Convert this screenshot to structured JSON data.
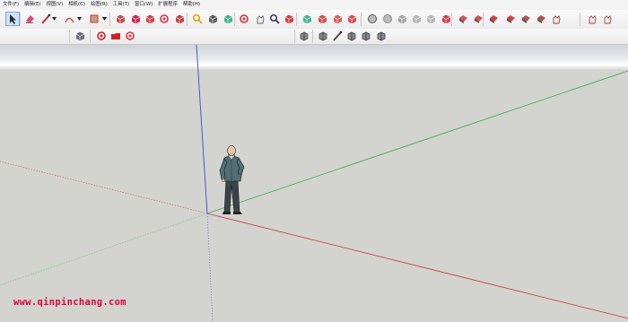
{
  "menu": [
    "文件(F)",
    "编辑(E)",
    "视图(V)",
    "相机(C)",
    "绘图(R)",
    "工具(T)",
    "窗口(W)",
    "扩展程序",
    "帮助(H)"
  ],
  "toolbar": {
    "tools": [
      {
        "name": "select-tool-icon",
        "color": "#2a2a2a"
      },
      {
        "name": "eraser-tool-icon",
        "color": "#e0487a"
      },
      {
        "name": "line-tool-icon",
        "color": "#c0202a"
      },
      {
        "name": "arc-tool-icon",
        "color": "#d24040"
      },
      {
        "name": "rectangle-tool-icon",
        "color": "#c83434"
      },
      {
        "name": "push-pull-tool-icon",
        "color": "#b33"
      },
      {
        "name": "offset-tool-icon",
        "color": "#c03"
      },
      {
        "name": "move-tool-icon",
        "color": "#c22"
      },
      {
        "name": "rotate-tool-icon",
        "color": "#c33"
      },
      {
        "name": "scale-tool-icon",
        "color": "#b22"
      },
      {
        "name": "tape-measure-icon",
        "color": "#e0a000"
      },
      {
        "name": "text-tool-icon",
        "color": "#444"
      },
      {
        "name": "paint-bucket-icon",
        "color": "#2a7"
      },
      {
        "name": "orbit-tool-icon",
        "color": "#c33"
      },
      {
        "name": "pan-tool-icon",
        "color": "#666"
      },
      {
        "name": "zoom-tool-icon",
        "color": "#336"
      },
      {
        "name": "zoom-extents-icon",
        "color": "#c22"
      },
      {
        "name": "warehouse-icon",
        "color": "#2a8"
      },
      {
        "name": "extension-warehouse-icon",
        "color": "#c33"
      },
      {
        "name": "component-icon",
        "color": "#c44"
      },
      {
        "name": "layout-icon",
        "color": "#c33"
      },
      {
        "name": "solid-tools-icon",
        "color": "#555"
      },
      {
        "name": "section-plane-icon",
        "color": "#888"
      },
      {
        "name": "sandbox-icon",
        "color": "#999"
      },
      {
        "name": "follow-me-icon",
        "color": "#aaa"
      },
      {
        "name": "intersect-icon",
        "color": "#aaa"
      },
      {
        "name": "outer-shell-icon",
        "color": "#c22"
      },
      {
        "name": "view-iso-icon",
        "color": "#c55"
      },
      {
        "name": "view-top-icon",
        "color": "#c55"
      },
      {
        "name": "view-front-icon",
        "color": "#c44"
      },
      {
        "name": "view-right-icon",
        "color": "#c44"
      },
      {
        "name": "view-back-icon",
        "color": "#a55"
      },
      {
        "name": "view-left-icon",
        "color": "#a55"
      },
      {
        "name": "hand-icon",
        "color": "#a33"
      },
      {
        "name": "walk-icon",
        "color": "#a44"
      },
      {
        "name": "look-around-icon",
        "color": "#a44"
      }
    ],
    "row2_left": [
      {
        "name": "position-camera-icon",
        "color": "#556"
      },
      {
        "name": "shadows-icon",
        "color": "#c22"
      },
      {
        "name": "folder-icon",
        "color": "#c22"
      },
      {
        "name": "fog-icon",
        "color": "#d33"
      }
    ],
    "row2_right": [
      {
        "name": "xray-style-icon",
        "color": "#555"
      },
      {
        "name": "wireframe-style-icon",
        "color": "#444"
      },
      {
        "name": "hidden-line-style-icon",
        "color": "#444"
      },
      {
        "name": "shaded-style-icon",
        "color": "#444"
      },
      {
        "name": "textured-style-icon",
        "color": "#446"
      },
      {
        "name": "monochrome-style-icon",
        "color": "#336"
      }
    ]
  },
  "watermark": "www.qinpinchang.com"
}
